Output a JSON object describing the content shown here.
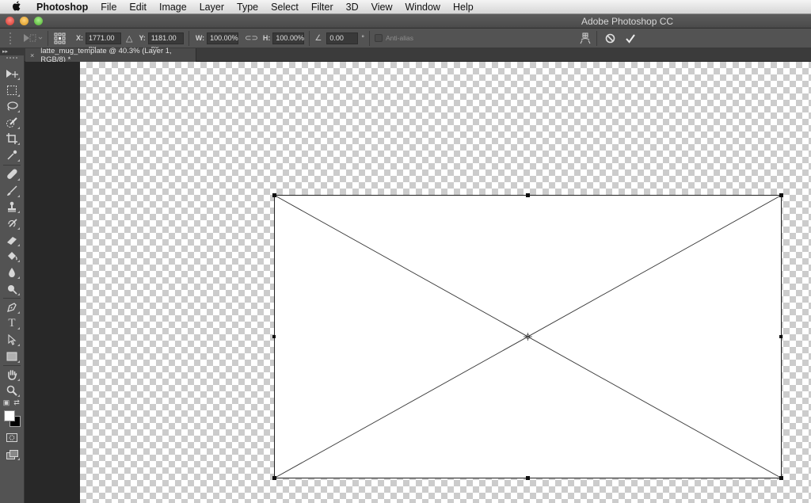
{
  "menubar": {
    "apple_icon": "apple-logo",
    "app_name": "Photoshop",
    "items": [
      "File",
      "Edit",
      "Image",
      "Layer",
      "Type",
      "Select",
      "Filter",
      "3D",
      "View",
      "Window",
      "Help"
    ]
  },
  "window": {
    "title": "Adobe Photoshop CC",
    "traffic_lights": {
      "close": "#e0443e",
      "minimize": "#dea123",
      "zoom": "#5fbf3a"
    }
  },
  "options_bar": {
    "reference_point_icon": "reference-point-grid-icon",
    "x_label": "X:",
    "x_value": "1771.00 px",
    "delta_icon": "relative-position-icon",
    "y_label": "Y:",
    "y_value": "1181.00 px",
    "w_label": "W:",
    "w_value": "100.00%",
    "link_icon": "link-icon",
    "h_label": "H:",
    "h_value": "100.00%",
    "angle_icon": "angle-icon",
    "angle_value": "0.00",
    "degree_symbol": "°",
    "antialias_label": "Anti-alias",
    "antialias_checked": false,
    "warp_icon": "warp-mode-icon",
    "cancel_icon": "cancel-transform-icon",
    "commit_icon": "commit-transform-icon"
  },
  "document_tab": {
    "close": "×",
    "title": "latte_mug_template @ 40.3% (Layer 1, RGB/8) *"
  },
  "toolbar": {
    "collapse": "▸▸",
    "tools": [
      {
        "name": "move-tool",
        "glyph": "⇱"
      },
      {
        "name": "rectangular-marquee-tool",
        "glyph": "⬚"
      },
      {
        "name": "lasso-tool",
        "glyph": "◌"
      },
      {
        "name": "quick-selection-tool",
        "glyph": "✎"
      },
      {
        "name": "crop-tool",
        "glyph": "⌗"
      },
      {
        "name": "eyedropper-tool",
        "glyph": "⁄"
      },
      {
        "name": "spot-healing-brush-tool",
        "glyph": "✚"
      },
      {
        "name": "brush-tool",
        "glyph": "🖌"
      },
      {
        "name": "clone-stamp-tool",
        "glyph": "⊥"
      },
      {
        "name": "history-brush-tool",
        "glyph": "↺"
      },
      {
        "name": "eraser-tool",
        "glyph": "▱"
      },
      {
        "name": "paint-bucket-tool",
        "glyph": "◒"
      },
      {
        "name": "blur-tool",
        "glyph": "💧"
      },
      {
        "name": "dodge-tool",
        "glyph": "⚲"
      },
      {
        "name": "pen-tool",
        "glyph": "✒"
      },
      {
        "name": "type-tool",
        "glyph": "T"
      },
      {
        "name": "path-selection-tool",
        "glyph": "➤"
      },
      {
        "name": "rectangle-tool",
        "glyph": "■"
      },
      {
        "name": "hand-tool",
        "glyph": "✋"
      },
      {
        "name": "zoom-tool",
        "glyph": "🔍"
      }
    ],
    "default_colors_icon": "▣",
    "swap_colors_icon": "⇄",
    "foreground_color": "#ffffff",
    "background_color": "#000000",
    "quick_mask_icon": "◘",
    "screen_mode_icon": "❐"
  },
  "canvas": {
    "layer_fill": "#ffffff",
    "transparency_checker": [
      "#ffffff",
      "#cccccc"
    ],
    "transform_handles": [
      "top-left",
      "top-center",
      "top-right",
      "middle-left",
      "middle-right",
      "bottom-left",
      "bottom-center",
      "bottom-right"
    ],
    "center_point_icon": "reference-point-crosshair"
  }
}
